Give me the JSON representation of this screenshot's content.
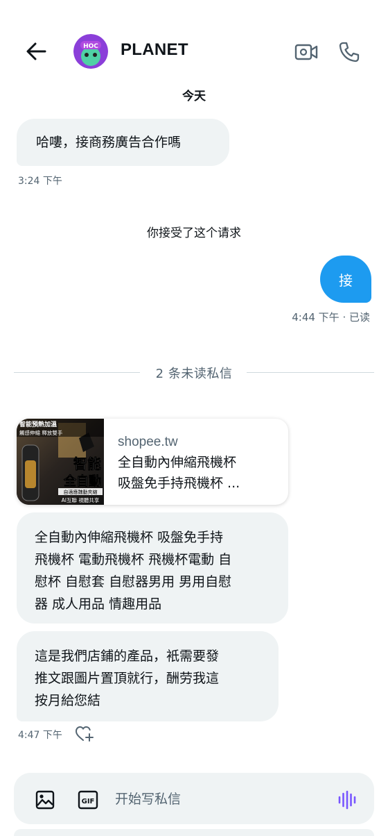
{
  "header": {
    "title": "PLANET",
    "avatar_text": "HOC"
  },
  "conversation": {
    "date_label": "今天",
    "messages": [
      {
        "text": "哈嘍，接商務廣告合作嗎",
        "time": "3:24 下午"
      }
    ],
    "system_note": "你接受了这个请求",
    "outgoing": {
      "text": "接",
      "status": "4:44 下午 · 已读"
    },
    "unread_divider": "2 条未读私信",
    "link_card": {
      "domain": "shopee.tw",
      "title_line1": "全自動內伸縮飛機杯",
      "title_line2": "吸盤免手持飛機杯 ...",
      "image_text": {
        "top_left_line1": "智能預熱加溫",
        "top_left_line2": "觸感伸縮 釋放雙手",
        "big_line1": "智能",
        "big_line2": "全自動",
        "sub": "自適應魏動夾縮",
        "bottom": "AI互聯 視聽共享"
      }
    },
    "message2": {
      "lines": [
        "全自動內伸縮飛機杯 吸盤免手持",
        "飛機杯 電動飛機杯 飛機杯電動 自",
        "慰杯 自慰套 自慰器男用 男用自慰",
        "器 成人用品 情趣用品"
      ]
    },
    "message3": {
      "lines": [
        "這是我們店鋪的產品，衹需要發",
        "推文跟圖片置頂就行，酬劳我這",
        "按月給您結"
      ],
      "time": "4:47 下午"
    }
  },
  "composer": {
    "placeholder": "开始写私信",
    "gif_label": "GIF"
  },
  "colors": {
    "accent": "#1d9bf0",
    "bubble_bg": "#eff3f4",
    "muted_text": "#536471",
    "voice_icon": "#7856ff"
  },
  "icons": {
    "back": "arrow-left-icon",
    "video": "video-call-icon",
    "phone": "phone-call-icon",
    "image": "image-icon",
    "gif": "gif-icon",
    "voice": "voice-wave-icon",
    "react": "heart-plus-icon"
  }
}
